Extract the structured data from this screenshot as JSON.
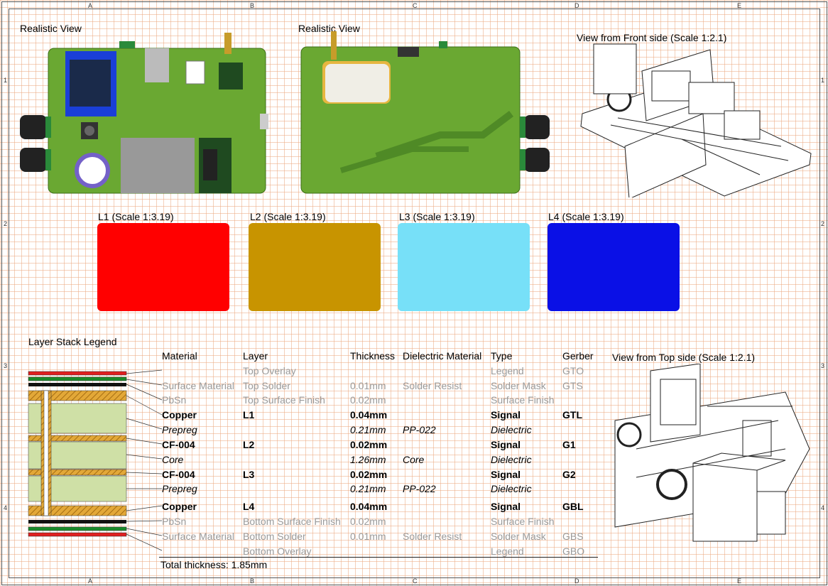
{
  "zones": {
    "cols": [
      "A",
      "B",
      "C",
      "D",
      "E"
    ],
    "rows": [
      "1",
      "2",
      "3",
      "4"
    ]
  },
  "views": {
    "realistic_front": "Realistic View",
    "realistic_back": "Realistic View",
    "front_side": "View from Front side (Scale 1:2.1)",
    "top_side": "View from Top side (Scale 1:2.1)"
  },
  "layers": [
    {
      "label": "L1 (Scale 1:3.19)",
      "color": "#ff0000"
    },
    {
      "label": "L2 (Scale 1:3.19)",
      "color": "#c89400"
    },
    {
      "label": "L3 (Scale 1:3.19)",
      "color": "#77e0f8"
    },
    {
      "label": "L4 (Scale 1:3.19)",
      "color": "#0a10e6"
    }
  ],
  "legend": {
    "title": "Layer Stack Legend",
    "headers": {
      "material": "Material",
      "layer": "Layer",
      "thickness": "Thickness",
      "dielectric": "Dielectric Material",
      "type": "Type",
      "gerber": "Gerber"
    },
    "rows": [
      {
        "material": "",
        "layer": "Top Overlay",
        "thickness": "",
        "dielectric": "",
        "type": "Legend",
        "gerber": "GTO",
        "style": "grey"
      },
      {
        "material": "Surface Material",
        "layer": "Top Solder",
        "thickness": "0.01mm",
        "dielectric": "Solder Resist",
        "type": "Solder Mask",
        "gerber": "GTS",
        "style": "grey"
      },
      {
        "material": "PbSn",
        "layer": "Top Surface Finish",
        "thickness": "0.02mm",
        "dielectric": "",
        "type": "Surface Finish",
        "gerber": "",
        "style": "grey"
      },
      {
        "material": "Copper",
        "layer": "L1",
        "thickness": "0.04mm",
        "dielectric": "",
        "type": "Signal",
        "gerber": "GTL",
        "style": "bold"
      },
      {
        "material": "Prepreg",
        "layer": "",
        "thickness": "0.21mm",
        "dielectric": "PP-022",
        "type": "Dielectric",
        "gerber": "",
        "style": "ital"
      },
      {
        "material": "CF-004",
        "layer": "L2",
        "thickness": "0.02mm",
        "dielectric": "",
        "type": "Signal",
        "gerber": "G1",
        "style": "bold"
      },
      {
        "material": "Core",
        "layer": "",
        "thickness": "1.26mm",
        "dielectric": "Core",
        "type": "Dielectric",
        "gerber": "",
        "style": "ital"
      },
      {
        "material": "CF-004",
        "layer": "L3",
        "thickness": "0.02mm",
        "dielectric": "",
        "type": "Signal",
        "gerber": "G2",
        "style": "bold"
      },
      {
        "material": "Prepreg",
        "layer": "",
        "thickness": "0.21mm",
        "dielectric": "PP-022",
        "type": "Dielectric",
        "gerber": "",
        "style": "ital"
      },
      {
        "material": "Copper",
        "layer": "L4",
        "thickness": "0.04mm",
        "dielectric": "",
        "type": "Signal",
        "gerber": "GBL",
        "style": "bold"
      },
      {
        "material": "PbSn",
        "layer": "Bottom Surface Finish",
        "thickness": "0.02mm",
        "dielectric": "",
        "type": "Surface Finish",
        "gerber": "",
        "style": "grey"
      },
      {
        "material": "Surface Material",
        "layer": "Bottom Solder",
        "thickness": "0.01mm",
        "dielectric": "Solder Resist",
        "type": "Solder Mask",
        "gerber": "GBS",
        "style": "grey"
      },
      {
        "material": "",
        "layer": "Bottom Overlay",
        "thickness": "",
        "dielectric": "",
        "type": "Legend",
        "gerber": "GBO",
        "style": "grey"
      }
    ],
    "total": "Total thickness: 1.85mm"
  },
  "colors": {
    "pcb_green": "#6aa832",
    "copper": "#d8a640",
    "grid": "#f0b08a"
  }
}
